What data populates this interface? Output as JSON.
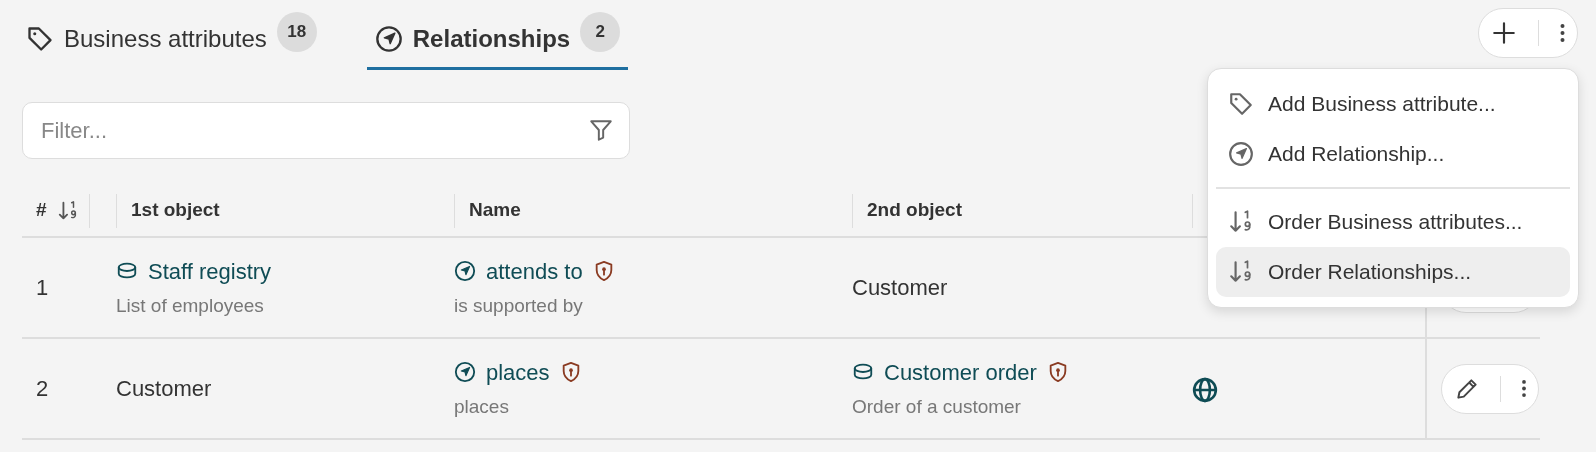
{
  "tabs": [
    {
      "label": "Business attributes",
      "count": "18",
      "kind": "attribute",
      "selected": false
    },
    {
      "label": "Relationships",
      "count": "2",
      "kind": "relationship",
      "selected": true
    }
  ],
  "filter": {
    "placeholder": "Filter..."
  },
  "table": {
    "columns": [
      {
        "label": "#",
        "sortable": true
      },
      {
        "label": "1st object",
        "sortable": false
      },
      {
        "label": "Name",
        "sortable": false
      },
      {
        "label": "2nd object",
        "sortable": false
      }
    ],
    "rows": [
      {
        "number": "1",
        "first": {
          "kind": "object",
          "title": "Staff registry",
          "subtitle": "List of employees",
          "protected": false
        },
        "name": {
          "kind": "relation",
          "title": "attends to",
          "subtitle": "is supported by",
          "protected": true
        },
        "second": {
          "kind": "plain",
          "title": "Customer"
        },
        "public": false
      },
      {
        "number": "2",
        "first": {
          "kind": "plain",
          "title": "Customer"
        },
        "name": {
          "kind": "relation",
          "title": "places",
          "subtitle": "places",
          "protected": true
        },
        "second": {
          "kind": "object",
          "title": "Customer order",
          "subtitle": "Order of a customer",
          "protected": true
        },
        "public": true
      }
    ]
  },
  "menu": {
    "groups": [
      [
        {
          "label": "Add Business attribute...",
          "kind": "attribute",
          "highlighted": false
        },
        {
          "label": "Add Relationship...",
          "kind": "relationship",
          "highlighted": false
        }
      ],
      [
        {
          "label": "Order Business attributes...",
          "kind": "order",
          "highlighted": false
        },
        {
          "label": "Order Relationships...",
          "kind": "order",
          "highlighted": true
        }
      ]
    ]
  }
}
